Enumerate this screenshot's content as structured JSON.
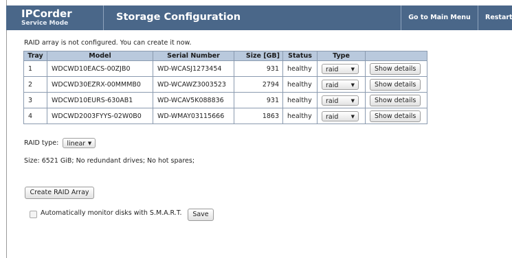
{
  "header": {
    "brand_title": "IPCorder",
    "brand_subtitle": "Service Mode",
    "page_title": "Storage Configuration",
    "nav_main_menu": "Go to Main Menu",
    "nav_restart": "Restart"
  },
  "notice": "RAID array is not configured. You can create it now.",
  "table": {
    "headers": [
      "Tray",
      "Model",
      "Serial Number",
      "Size [GB]",
      "Status",
      "Type",
      ""
    ],
    "rows": [
      {
        "tray": "1",
        "model": "WDCWD10EACS-00ZJB0",
        "serial": "WD-WCASJ1273454",
        "size": "931",
        "status": "healthy",
        "type": "raid",
        "action": "Show details"
      },
      {
        "tray": "2",
        "model": "WDCWD30EZRX-00MMMB0",
        "serial": "WD-WCAWZ3003523",
        "size": "2794",
        "status": "healthy",
        "type": "raid",
        "action": "Show details"
      },
      {
        "tray": "3",
        "model": "WDCWD10EURS-630AB1",
        "serial": "WD-WCAV5K088836",
        "size": "931",
        "status": "healthy",
        "type": "raid",
        "action": "Show details"
      },
      {
        "tray": "4",
        "model": "WDCWD2003FYYS-02W0B0",
        "serial": "WD-WMAY03115666",
        "size": "1863",
        "status": "healthy",
        "type": "raid",
        "action": "Show details"
      }
    ]
  },
  "raid_type": {
    "label": "RAID type:",
    "value": "linear"
  },
  "size_summary": "Size: 6521 GiB; No redundant drives; No hot spares;",
  "create_button": "Create RAID Array",
  "smart": {
    "label": "Automatically monitor disks with S.M.A.R.T.",
    "checked": false,
    "save_label": "Save"
  },
  "icons": {
    "dropdown_arrow": "chevron-down-icon"
  },
  "colors": {
    "header_bg": "#4a6789",
    "table_header_bg": "#b9c9dd"
  }
}
